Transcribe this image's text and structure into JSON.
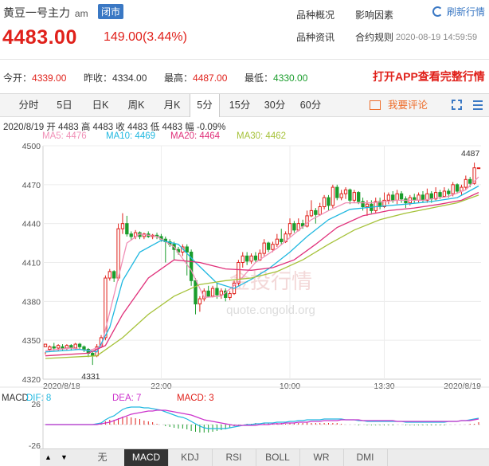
{
  "header": {
    "name": "黄豆一号主力",
    "session": "am",
    "status_badge": "闭市",
    "price": "4483.00",
    "change": "149.00(3.44%)",
    "links": [
      "品种概况",
      "影响因素",
      "品种资讯",
      "合约规则"
    ],
    "refresh_label": "刷新行情",
    "datetime": "2020-08-19 14:59:59",
    "promo": "打开APP查看完整行情"
  },
  "stats": [
    {
      "label": "今开：",
      "value": "4339.00",
      "color": "red"
    },
    {
      "label": "昨收：",
      "value": "4334.00",
      "color": "black"
    },
    {
      "label": "最高：",
      "value": "4487.00",
      "color": "red"
    },
    {
      "label": "最低：",
      "value": "4330.00",
      "color": "green"
    }
  ],
  "tabs": [
    "分时",
    "5日",
    "日K",
    "周K",
    "月K",
    "5分",
    "15分",
    "30分",
    "60分"
  ],
  "active_tab": "5分",
  "comment_label": "我要评论",
  "ohlc_line": "2020/8/19  开 4483  高 4483  收 4483  低 4483  幅 -0.09%",
  "ma_labels": [
    {
      "text": "MA5: 4476",
      "color": "#f08fb6"
    },
    {
      "text": "MA10: 4469",
      "color": "#20b8e0"
    },
    {
      "text": "MA20: 4464",
      "color": "#e0307a"
    },
    {
      "text": "MA30: 4462",
      "color": "#a6c23a"
    }
  ],
  "macd_labels": [
    {
      "text": "MACD",
      "color": "#333333"
    },
    {
      "text": "DIF: 8",
      "color": "#20b8e0"
    },
    {
      "text": "DEA: 7",
      "color": "#cc33cc"
    },
    {
      "text": "MACD: 3",
      "color": "#e0211b"
    }
  ],
  "watermark": {
    "main": "金投行情",
    "sub": "quote.cngold.org"
  },
  "bottom_tabs": [
    "无",
    "MACD",
    "KDJ",
    "RSI",
    "BOLL",
    "WR",
    "DMI"
  ],
  "bottom_active": "MACD",
  "chart_data": {
    "type": "candlestick",
    "ylim": [
      4320,
      4500
    ],
    "yticks": [
      4320,
      4350,
      4380,
      4410,
      4440,
      4470,
      4500
    ],
    "xticks": [
      {
        "label": "2020/8/18",
        "index": 0
      },
      {
        "label": "22:00",
        "index": 27
      },
      {
        "label": "10:00",
        "index": 57
      },
      {
        "label": "13:30",
        "index": 79
      },
      {
        "label": "2020/8/19",
        "index": 98
      }
    ],
    "annotations": [
      {
        "text": "4331",
        "index": 11,
        "value": 4331
      },
      {
        "text": "4487",
        "index": 101,
        "value": 4487
      }
    ],
    "candles": [
      [
        4345,
        4347,
        4341,
        4339
      ],
      [
        4343,
        4345,
        4346,
        4341
      ],
      [
        4345,
        4344,
        4348,
        4342
      ],
      [
        4344,
        4346,
        4347,
        4342
      ],
      [
        4345,
        4344,
        4347,
        4342
      ],
      [
        4344,
        4346,
        4347,
        4342
      ],
      [
        4346,
        4344,
        4347,
        4342
      ],
      [
        4344,
        4347,
        4348,
        4343
      ],
      [
        4347,
        4345,
        4348,
        4343
      ],
      [
        4345,
        4343,
        4346,
        4341
      ],
      [
        4343,
        4340,
        4344,
        4337
      ],
      [
        4340,
        4338,
        4341,
        4331
      ],
      [
        4338,
        4345,
        4347,
        4337
      ],
      [
        4345,
        4352,
        4354,
        4344
      ],
      [
        4352,
        4398,
        4400,
        4350
      ],
      [
        4398,
        4403,
        4405,
        4396
      ],
      [
        4403,
        4398,
        4404,
        4395
      ],
      [
        4398,
        4436,
        4440,
        4396
      ],
      [
        4436,
        4440,
        4448,
        4432
      ],
      [
        4440,
        4432,
        4446,
        4430
      ],
      [
        4432,
        4430,
        4434,
        4427
      ],
      [
        4430,
        4433,
        4435,
        4428
      ],
      [
        4433,
        4430,
        4434,
        4428
      ],
      [
        4430,
        4432,
        4433,
        4428
      ],
      [
        4432,
        4430,
        4434,
        4429
      ],
      [
        4430,
        4431,
        4432,
        4428
      ],
      [
        4431,
        4430,
        4433,
        4428
      ],
      [
        4430,
        4428,
        4432,
        4426
      ],
      [
        4428,
        4426,
        4430,
        4410
      ],
      [
        4426,
        4424,
        4428,
        4422
      ],
      [
        4424,
        4420,
        4426,
        4412
      ],
      [
        4420,
        4418,
        4422,
        4416
      ],
      [
        4418,
        4422,
        4424,
        4415
      ],
      [
        4422,
        4418,
        4424,
        4400
      ],
      [
        4418,
        4396,
        4420,
        4392
      ],
      [
        4396,
        4378,
        4398,
        4370
      ],
      [
        4378,
        4382,
        4384,
        4372
      ],
      [
        4382,
        4388,
        4390,
        4380
      ],
      [
        4388,
        4384,
        4392,
        4383
      ],
      [
        4384,
        4390,
        4392,
        4383
      ],
      [
        4390,
        4385,
        4394,
        4382
      ],
      [
        4385,
        4388,
        4390,
        4382
      ],
      [
        4388,
        4383,
        4390,
        4380
      ],
      [
        4383,
        4386,
        4388,
        4381
      ],
      [
        4386,
        4394,
        4396,
        4385
      ],
      [
        4394,
        4410,
        4412,
        4392
      ],
      [
        4410,
        4415,
        4418,
        4406
      ],
      [
        4415,
        4411,
        4418,
        4408
      ],
      [
        4411,
        4415,
        4417,
        4409
      ],
      [
        4415,
        4412,
        4418,
        4410
      ],
      [
        4412,
        4417,
        4420,
        4411
      ],
      [
        4417,
        4425,
        4428,
        4415
      ],
      [
        4425,
        4420,
        4426,
        4418
      ],
      [
        4420,
        4424,
        4426,
        4418
      ],
      [
        4424,
        4428,
        4432,
        4422
      ],
      [
        4428,
        4426,
        4436,
        4424
      ],
      [
        4426,
        4432,
        4434,
        4425
      ],
      [
        4432,
        4440,
        4444,
        4430
      ],
      [
        4440,
        4435,
        4442,
        4433
      ],
      [
        4435,
        4440,
        4444,
        4434
      ],
      [
        4440,
        4438,
        4443,
        4436
      ],
      [
        4438,
        4446,
        4450,
        4437
      ],
      [
        4446,
        4450,
        4458,
        4445
      ],
      [
        4450,
        4447,
        4452,
        4440
      ],
      [
        4447,
        4453,
        4456,
        4446
      ],
      [
        4453,
        4460,
        4462,
        4451
      ],
      [
        4460,
        4454,
        4462,
        4450
      ],
      [
        4454,
        4468,
        4470,
        4452
      ],
      [
        4468,
        4460,
        4470,
        4458
      ],
      [
        4460,
        4463,
        4466,
        4458
      ],
      [
        4463,
        4466,
        4468,
        4459
      ],
      [
        4466,
        4458,
        4467,
        4455
      ],
      [
        4458,
        4464,
        4466,
        4456
      ],
      [
        4464,
        4457,
        4465,
        4455
      ],
      [
        4457,
        4453,
        4460,
        4450
      ],
      [
        4453,
        4455,
        4458,
        4446
      ],
      [
        4455,
        4450,
        4458,
        4448
      ],
      [
        4450,
        4457,
        4460,
        4448
      ],
      [
        4457,
        4453,
        4460,
        4451
      ],
      [
        4453,
        4458,
        4464,
        4452
      ],
      [
        4458,
        4462,
        4464,
        4455
      ],
      [
        4462,
        4458,
        4465,
        4456
      ],
      [
        4458,
        4463,
        4466,
        4455
      ],
      [
        4463,
        4459,
        4465,
        4456
      ],
      [
        4459,
        4456,
        4461,
        4452
      ],
      [
        4456,
        4460,
        4462,
        4454
      ],
      [
        4460,
        4458,
        4463,
        4456
      ],
      [
        4458,
        4462,
        4464,
        4456
      ],
      [
        4462,
        4458,
        4465,
        4456
      ],
      [
        4458,
        4463,
        4467,
        4456
      ],
      [
        4463,
        4459,
        4465,
        4456
      ],
      [
        4459,
        4464,
        4468,
        4458
      ],
      [
        4464,
        4461,
        4466,
        4459
      ],
      [
        4461,
        4465,
        4468,
        4460
      ],
      [
        4465,
        4463,
        4467,
        4460
      ],
      [
        4463,
        4470,
        4472,
        4461
      ],
      [
        4470,
        4465,
        4471,
        4463
      ],
      [
        4465,
        4468,
        4470,
        4462
      ],
      [
        4468,
        4474,
        4477,
        4466
      ],
      [
        4474,
        4471,
        4476,
        4468
      ],
      [
        4471,
        4483,
        4487,
        4470
      ],
      [
        4483,
        4483,
        4483,
        4483
      ]
    ],
    "ma": {
      "MA5": {
        "color": "#f08fb6",
        "points": [
          [
            0,
            4342
          ],
          [
            6,
            4344
          ],
          [
            10,
            4342
          ],
          [
            13,
            4345
          ],
          [
            16,
            4385
          ],
          [
            19,
            4425
          ],
          [
            22,
            4432
          ],
          [
            26,
            4430
          ],
          [
            30,
            4422
          ],
          [
            34,
            4404
          ],
          [
            37,
            4383
          ],
          [
            41,
            4384
          ],
          [
            45,
            4395
          ],
          [
            49,
            4410
          ],
          [
            54,
            4421
          ],
          [
            58,
            4432
          ],
          [
            62,
            4443
          ],
          [
            66,
            4450
          ],
          [
            70,
            4456
          ],
          [
            76,
            4456
          ],
          [
            82,
            4458
          ],
          [
            88,
            4458
          ],
          [
            94,
            4461
          ],
          [
            98,
            4466
          ],
          [
            101,
            4476
          ]
        ]
      },
      "MA10": {
        "color": "#20b8e0",
        "points": [
          [
            0,
            4341
          ],
          [
            8,
            4343
          ],
          [
            12,
            4341
          ],
          [
            15,
            4360
          ],
          [
            18,
            4396
          ],
          [
            22,
            4418
          ],
          [
            27,
            4427
          ],
          [
            31,
            4424
          ],
          [
            35,
            4410
          ],
          [
            40,
            4394
          ],
          [
            44,
            4390
          ],
          [
            48,
            4397
          ],
          [
            52,
            4405
          ],
          [
            57,
            4418
          ],
          [
            61,
            4430
          ],
          [
            66,
            4443
          ],
          [
            71,
            4451
          ],
          [
            77,
            4453
          ],
          [
            84,
            4455
          ],
          [
            90,
            4457
          ],
          [
            96,
            4460
          ],
          [
            101,
            4469
          ]
        ]
      },
      "MA20": {
        "color": "#e0307a",
        "points": [
          [
            0,
            4338
          ],
          [
            10,
            4340
          ],
          [
            14,
            4346
          ],
          [
            18,
            4370
          ],
          [
            24,
            4398
          ],
          [
            30,
            4412
          ],
          [
            36,
            4410
          ],
          [
            42,
            4405
          ],
          [
            48,
            4404
          ],
          [
            53,
            4406
          ],
          [
            58,
            4412
          ],
          [
            63,
            4424
          ],
          [
            68,
            4437
          ],
          [
            74,
            4446
          ],
          [
            80,
            4450
          ],
          [
            86,
            4452
          ],
          [
            92,
            4455
          ],
          [
            97,
            4458
          ],
          [
            101,
            4464
          ]
        ]
      },
      "MA30": {
        "color": "#a6c23a",
        "points": [
          [
            0,
            4336
          ],
          [
            12,
            4338
          ],
          [
            18,
            4352
          ],
          [
            24,
            4370
          ],
          [
            30,
            4384
          ],
          [
            36,
            4393
          ],
          [
            42,
            4396
          ],
          [
            48,
            4398
          ],
          [
            54,
            4403
          ],
          [
            60,
            4412
          ],
          [
            66,
            4424
          ],
          [
            72,
            4435
          ],
          [
            78,
            4443
          ],
          [
            84,
            4448
          ],
          [
            90,
            4452
          ],
          [
            96,
            4456
          ],
          [
            101,
            4462
          ]
        ]
      }
    },
    "macd": {
      "yticks": [
        26,
        0,
        -26
      ],
      "ylim": [
        -30,
        30
      ],
      "dif": [
        0,
        0,
        0,
        0,
        0,
        0,
        0,
        0,
        0,
        0,
        0,
        0,
        1,
        2,
        6,
        9,
        11,
        15,
        19,
        21,
        22,
        22,
        22,
        21,
        21,
        20,
        19,
        18,
        16,
        14,
        12,
        10,
        9,
        7,
        4,
        1,
        -2,
        -4,
        -5,
        -5,
        -5,
        -5,
        -5,
        -4,
        -3,
        -2,
        -1,
        0,
        0,
        1,
        1,
        2,
        2,
        2,
        3,
        3,
        3,
        4,
        4,
        5,
        5,
        6,
        6,
        6,
        6,
        7,
        7,
        7,
        7,
        7,
        6,
        6,
        6,
        5,
        5,
        4,
        4,
        4,
        4,
        4,
        4,
        4,
        4,
        4,
        3,
        3,
        3,
        3,
        3,
        3,
        3,
        3,
        3,
        3,
        4,
        4,
        4,
        5,
        5,
        6,
        7,
        8
      ],
      "dea": [
        0,
        0,
        0,
        0,
        0,
        0,
        0,
        0,
        0,
        0,
        0,
        0,
        0,
        1,
        2,
        3,
        5,
        7,
        9,
        11,
        13,
        14,
        15,
        16,
        17,
        17,
        18,
        18,
        18,
        17,
        16,
        15,
        14,
        13,
        12,
        10,
        8,
        6,
        5,
        4,
        3,
        2,
        1,
        0,
        -1,
        -1,
        -1,
        -1,
        -1,
        -1,
        0,
        0,
        0,
        1,
        1,
        1,
        2,
        2,
        2,
        3,
        3,
        3,
        4,
        4,
        4,
        5,
        5,
        5,
        5,
        6,
        6,
        6,
        6,
        6,
        5,
        5,
        5,
        5,
        5,
        5,
        5,
        5,
        4,
        4,
        4,
        4,
        4,
        4,
        4,
        4,
        4,
        4,
        4,
        4,
        4,
        4,
        4,
        5,
        5,
        5,
        6,
        7
      ],
      "hist": [
        0,
        0,
        0,
        0,
        0,
        0,
        0,
        0,
        0,
        0,
        0,
        0,
        1,
        1,
        4,
        6,
        6,
        8,
        10,
        10,
        9,
        8,
        7,
        5,
        4,
        3,
        1,
        0,
        -2,
        -3,
        -4,
        -5,
        -5,
        -6,
        -8,
        -9,
        -10,
        -10,
        -10,
        -9,
        -8,
        -7,
        -6,
        -4,
        -2,
        -1,
        0,
        1,
        1,
        2,
        1,
        2,
        2,
        1,
        2,
        2,
        1,
        2,
        2,
        2,
        2,
        3,
        2,
        2,
        2,
        2,
        2,
        2,
        2,
        1,
        0,
        0,
        0,
        -1,
        0,
        -1,
        -1,
        -1,
        -1,
        -1,
        -1,
        -1,
        0,
        0,
        -1,
        -1,
        -1,
        -1,
        -1,
        -1,
        -1,
        -1,
        -1,
        -1,
        0,
        0,
        0,
        0,
        0,
        1,
        1,
        3
      ]
    }
  }
}
